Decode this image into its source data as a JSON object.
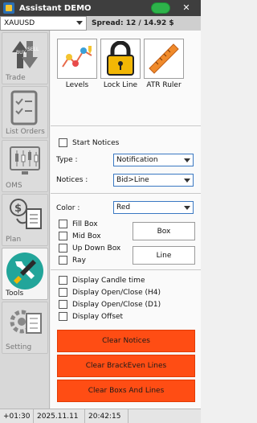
{
  "title": {
    "text": "Assistant DEMO",
    "close": "✕"
  },
  "symbol": {
    "value": "XAUUSD"
  },
  "spread": {
    "text": "Spread: 12 / 14.92 $"
  },
  "sidebar": {
    "items": [
      {
        "label": "Trade",
        "icon": "buy-sell-arrows-icon"
      },
      {
        "label": "List Orders",
        "icon": "checklist-icon"
      },
      {
        "label": "OMS",
        "icon": "candlestick-monitor-icon"
      },
      {
        "label": "Plan",
        "icon": "money-plan-icon"
      },
      {
        "label": "Tools",
        "icon": "wrench-screwdriver-icon"
      },
      {
        "label": "Setting",
        "icon": "gear-checklist-icon"
      }
    ]
  },
  "tools": {
    "levels": "Levels",
    "lock_line": "Lock Line",
    "atr_ruler": "ATR Ruler"
  },
  "notices": {
    "start_label": "Start Notices",
    "type_label": "Type :",
    "type_value": "Notification",
    "notices_label": "Notices :",
    "notices_value": "Bid>Line"
  },
  "color": {
    "label": "Color :",
    "value": "Red"
  },
  "boxes": {
    "fill_box": "Fill Box",
    "mid_box": "Mid Box",
    "up_down_box": "Up Down Box",
    "ray": "Ray",
    "box_button": "Box",
    "line_button": "Line"
  },
  "display": {
    "candle_time": "Display Candle time",
    "open_close_h4": "Display Open/Close (H4)",
    "open_close_d1": "Display Open/Close (D1)",
    "offset": "Display Offset"
  },
  "actions": {
    "clear_notices": "Clear Notices",
    "clear_breakeven": "Clear BrackEven Lines",
    "clear_boxs": "Clear Boxs And Lines"
  },
  "status": {
    "offset": "+01:30",
    "date": "2025.11.11",
    "time": "20:42:15"
  },
  "colors": {
    "accent_red": "#ff4d14",
    "titlebar": "#3e3e3e",
    "toggle_green": "#2db34a"
  }
}
